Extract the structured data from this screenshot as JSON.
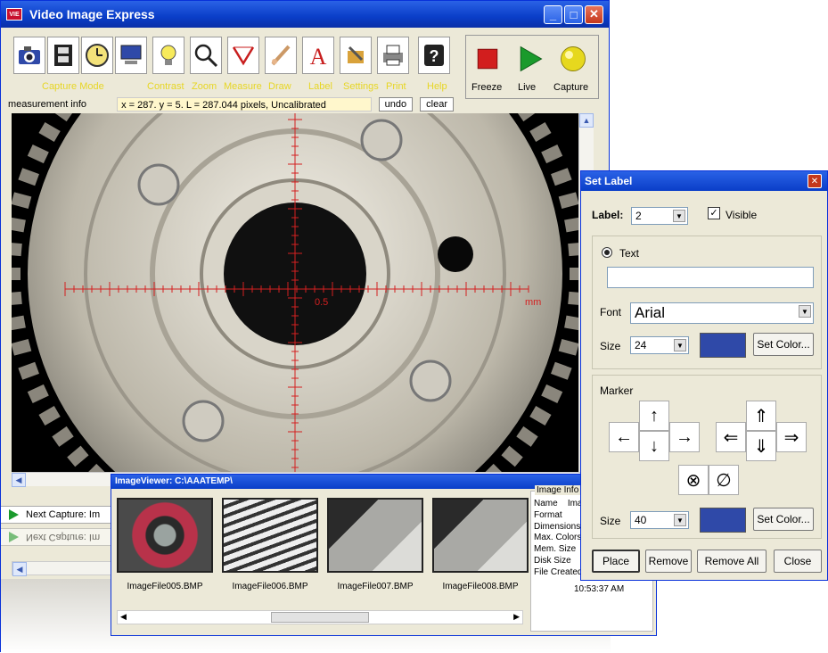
{
  "app": {
    "title": "Video Image Express",
    "badge": "VIE",
    "window_controls": {
      "min": "_",
      "max": "□",
      "close": "✕"
    }
  },
  "toolbar": {
    "captions": {
      "capture_mode": "Capture Mode",
      "contrast": "Contrast",
      "zoom": "Zoom",
      "measure": "Measure",
      "draw": "Draw",
      "label": "Label",
      "settings": "Settings",
      "print": "Print",
      "help": "Help"
    },
    "right": {
      "freeze": "Freeze",
      "live": "Live",
      "capture": "Capture"
    },
    "caption_color": "#e7d624"
  },
  "measurement": {
    "label": "measurement info",
    "value": "x = 287. y = 5. L = 287.044 pixels, Uncalibrated",
    "undo": "undo",
    "clear": "clear"
  },
  "image": {
    "scale_label": "0.5",
    "unit_label": "mm",
    "reticle_color": "#d42020"
  },
  "status": {
    "next_capture": "Next Capture: Im",
    "next_capture_mirror": "Next Capture: Im"
  },
  "viewer": {
    "title": "ImageViewer: C:\\AAATEMP\\",
    "thumbnails": [
      {
        "name": "ImageFile005.BMP"
      },
      {
        "name": "ImageFile006.BMP"
      },
      {
        "name": "ImageFile007.BMP"
      },
      {
        "name": "ImageFile008.BMP"
      }
    ],
    "info": {
      "heading": "Image Info",
      "name_label": "Name",
      "name_value": "Imag",
      "fields": [
        "Format",
        "Dimensions",
        "Max. Colors",
        "Mem. Size",
        "Disk Size",
        "File Created"
      ],
      "time": "10:53:37 AM"
    }
  },
  "set_label": {
    "title": "Set Label",
    "label_caption": "Label:",
    "label_value": "2",
    "visible_caption": "Visible",
    "text_option": "Text",
    "text_value": "",
    "font_caption": "Font",
    "font_value": "Arial",
    "size_caption": "Size",
    "text_size": "24",
    "set_color": "Set Color...",
    "marker_caption": "Marker",
    "marker_size_caption": "Size",
    "marker_size": "40",
    "marker_color": "#2f49a8",
    "buttons": {
      "place": "Place",
      "remove": "Remove",
      "remove_all": "Remove All",
      "close": "Close"
    },
    "markers": {
      "left": "←",
      "up": "↑",
      "down": "↓",
      "right": "→",
      "dleft": "⇐",
      "dup": "⇑",
      "ddown": "⇓",
      "dright": "⇒",
      "xcircle": "⊗",
      "slash": "∅"
    }
  }
}
